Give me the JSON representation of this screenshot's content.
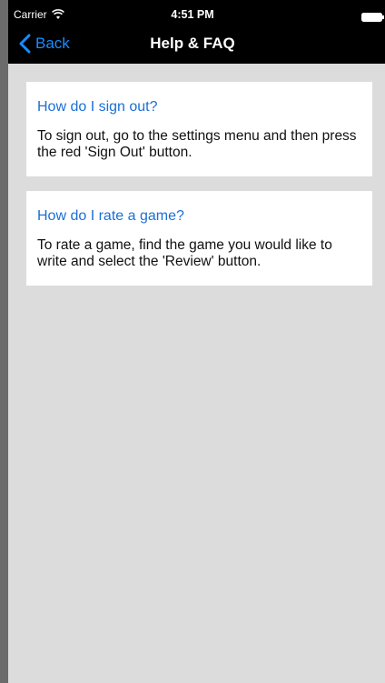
{
  "status_bar": {
    "carrier": "Carrier",
    "time": "4:51 PM",
    "wifi_icon": "wifi-icon",
    "battery_icon": "battery-icon"
  },
  "nav": {
    "back_label": "Back",
    "back_icon": "chevron-left-icon",
    "title": "Help & FAQ",
    "accent_color": "#1a8cff"
  },
  "faq": {
    "items": [
      {
        "question": "How do I sign out?",
        "answer": "To sign out, go to the settings menu and then press the red 'Sign Out' button."
      },
      {
        "question": "How do I rate a game?",
        "answer": "To rate a game, find the game you would like to write and select the 'Review' button."
      }
    ],
    "question_color": "#1a6fd6"
  }
}
